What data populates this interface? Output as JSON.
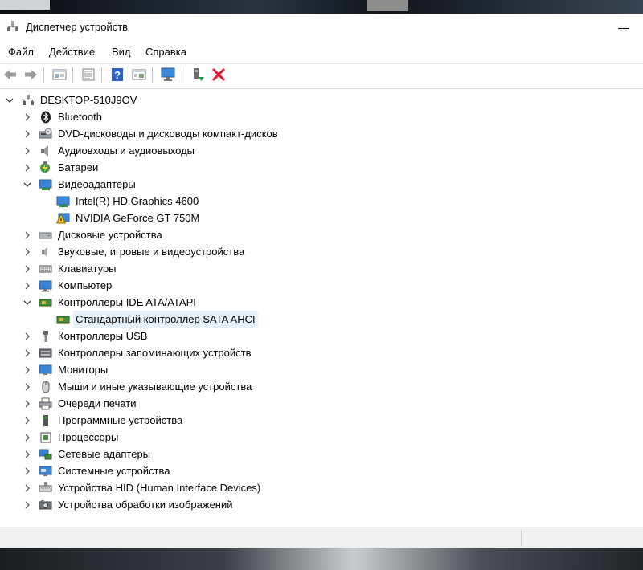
{
  "window": {
    "title": "Диспетчер устройств",
    "minimize_glyph": "—"
  },
  "menu": [
    "Файл",
    "Действие",
    "Вид",
    "Справка"
  ],
  "toolbar": {
    "buttons": [
      "back-icon",
      "forward-icon",
      "properties-icon",
      "list-view-icon",
      "help-icon",
      "resources-icon",
      "monitor-scan-icon",
      "enable-device-icon",
      "remove-device-icon"
    ]
  },
  "tree": {
    "root": "DESKTOP-510J9OV",
    "items": [
      {
        "label": "Bluetooth",
        "icon": "bluetooth-icon",
        "expanded": false
      },
      {
        "label": "DVD-дисководы и дисководы компакт-дисков",
        "icon": "dvd-drive-icon",
        "expanded": false
      },
      {
        "label": "Аудиовходы и аудиовыходы",
        "icon": "audio-io-icon",
        "expanded": false
      },
      {
        "label": "Батареи",
        "icon": "battery-icon",
        "expanded": false
      },
      {
        "label": "Видеоадаптеры",
        "icon": "display-adapter-icon",
        "expanded": true,
        "children": [
          {
            "label": "Intel(R) HD Graphics 4600",
            "icon": "display-adapter-icon"
          },
          {
            "label": "NVIDIA GeForce GT 750M",
            "icon": "warning-icon"
          }
        ]
      },
      {
        "label": "Дисковые устройства",
        "icon": "disk-drive-icon",
        "expanded": false
      },
      {
        "label": "Звуковые, игровые и видеоустройства",
        "icon": "speaker-icon",
        "expanded": false
      },
      {
        "label": "Клавиатуры",
        "icon": "keyboard-icon",
        "expanded": false
      },
      {
        "label": "Компьютер",
        "icon": "computer-icon",
        "expanded": false
      },
      {
        "label": "Контроллеры IDE ATA/ATAPI",
        "icon": "ide-controller-icon",
        "expanded": true,
        "children": [
          {
            "label": "Стандартный контроллер SATA AHCI",
            "icon": "ide-controller-icon",
            "selected": true
          }
        ]
      },
      {
        "label": "Контроллеры USB",
        "icon": "usb-icon",
        "expanded": false
      },
      {
        "label": "Контроллеры запоминающих устройств",
        "icon": "storage-controller-icon",
        "expanded": false
      },
      {
        "label": "Мониторы",
        "icon": "monitor-icon",
        "expanded": false
      },
      {
        "label": "Мыши и иные указывающие устройства",
        "icon": "mouse-icon",
        "expanded": false
      },
      {
        "label": "Очереди печати",
        "icon": "printer-icon",
        "expanded": false
      },
      {
        "label": "Программные устройства",
        "icon": "software-device-icon",
        "expanded": false
      },
      {
        "label": "Процессоры",
        "icon": "processor-icon",
        "expanded": false
      },
      {
        "label": "Сетевые адаптеры",
        "icon": "network-adapter-icon",
        "expanded": false
      },
      {
        "label": "Системные устройства",
        "icon": "system-device-icon",
        "expanded": false
      },
      {
        "label": "Устройства HID (Human Interface Devices)",
        "icon": "hid-icon",
        "expanded": false
      },
      {
        "label": "Устройства обработки изображений",
        "icon": "imaging-device-icon",
        "expanded": false
      }
    ]
  },
  "colors": {
    "selection": "#e5f1fb",
    "accent": "#0078d7",
    "remove": "#e81123"
  }
}
